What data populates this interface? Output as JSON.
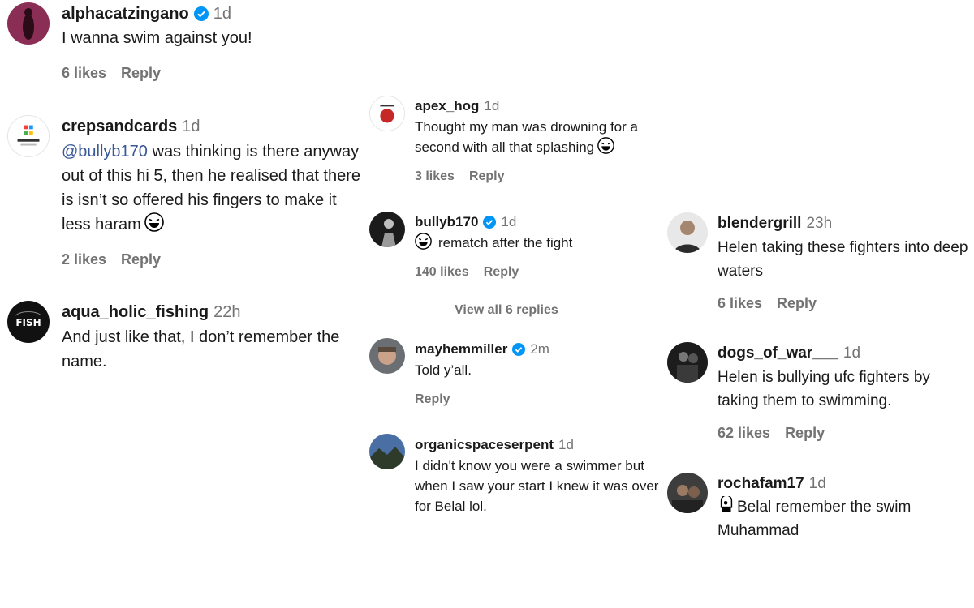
{
  "comments": [
    {
      "user": "alphacatzingano",
      "time": "1d",
      "verified": true,
      "text": "I wanna swim against you!",
      "likes": "6 likes",
      "reply": "Reply"
    },
    {
      "user": "crepsandcards",
      "time": "1d",
      "mention": "@bullyb170",
      "text": " was thinking is there anyway out of this hi 5, then he realised that there is isn’t so offered his fingers to make it less haram",
      "likes": "2 likes",
      "reply": "Reply"
    },
    {
      "user": "aqua_holic_fishing",
      "time": "22h",
      "text": "And just like that, I don’t remember the name."
    },
    {
      "user": "apex_hog",
      "time": "1d",
      "text": "Thought my man was drowning for a second with all that splashing",
      "likes": "3 likes",
      "reply": "Reply"
    },
    {
      "user": "bullyb170",
      "time": "1d",
      "verified": true,
      "text": "rematch after the fight",
      "likes": "140 likes",
      "reply": "Reply",
      "view_replies": "View all 6 replies"
    },
    {
      "user": "mayhemmiller",
      "time": "2m",
      "verified": true,
      "text": "Told y’all.",
      "reply": "Reply"
    },
    {
      "user": "organicspaceserpent",
      "time": "1d",
      "text": "I didn't know you were a swimmer but when I saw your start I knew it was over for Belal lol."
    },
    {
      "user": "blendergrill",
      "time": "23h",
      "text": "Helen taking these fighters into deep waters",
      "likes": "6 likes",
      "reply": "Reply"
    },
    {
      "user": "dogs_of_war___",
      "time": "1d",
      "text": "Helen is bullying ufc fighters by taking them to swimming.",
      "likes": "62 likes",
      "reply": "Reply"
    },
    {
      "user": "rochafam17",
      "time": "1d",
      "text": "Belal remember the swim Muhammad"
    }
  ],
  "icons": {
    "verified": "verified-badge-icon",
    "laugh": "tears-of-joy-emoji",
    "helmet": "boxing-glove-emoji"
  },
  "colors": {
    "verified": "#0095f6",
    "mention": "#385898",
    "muted": "#737373"
  }
}
